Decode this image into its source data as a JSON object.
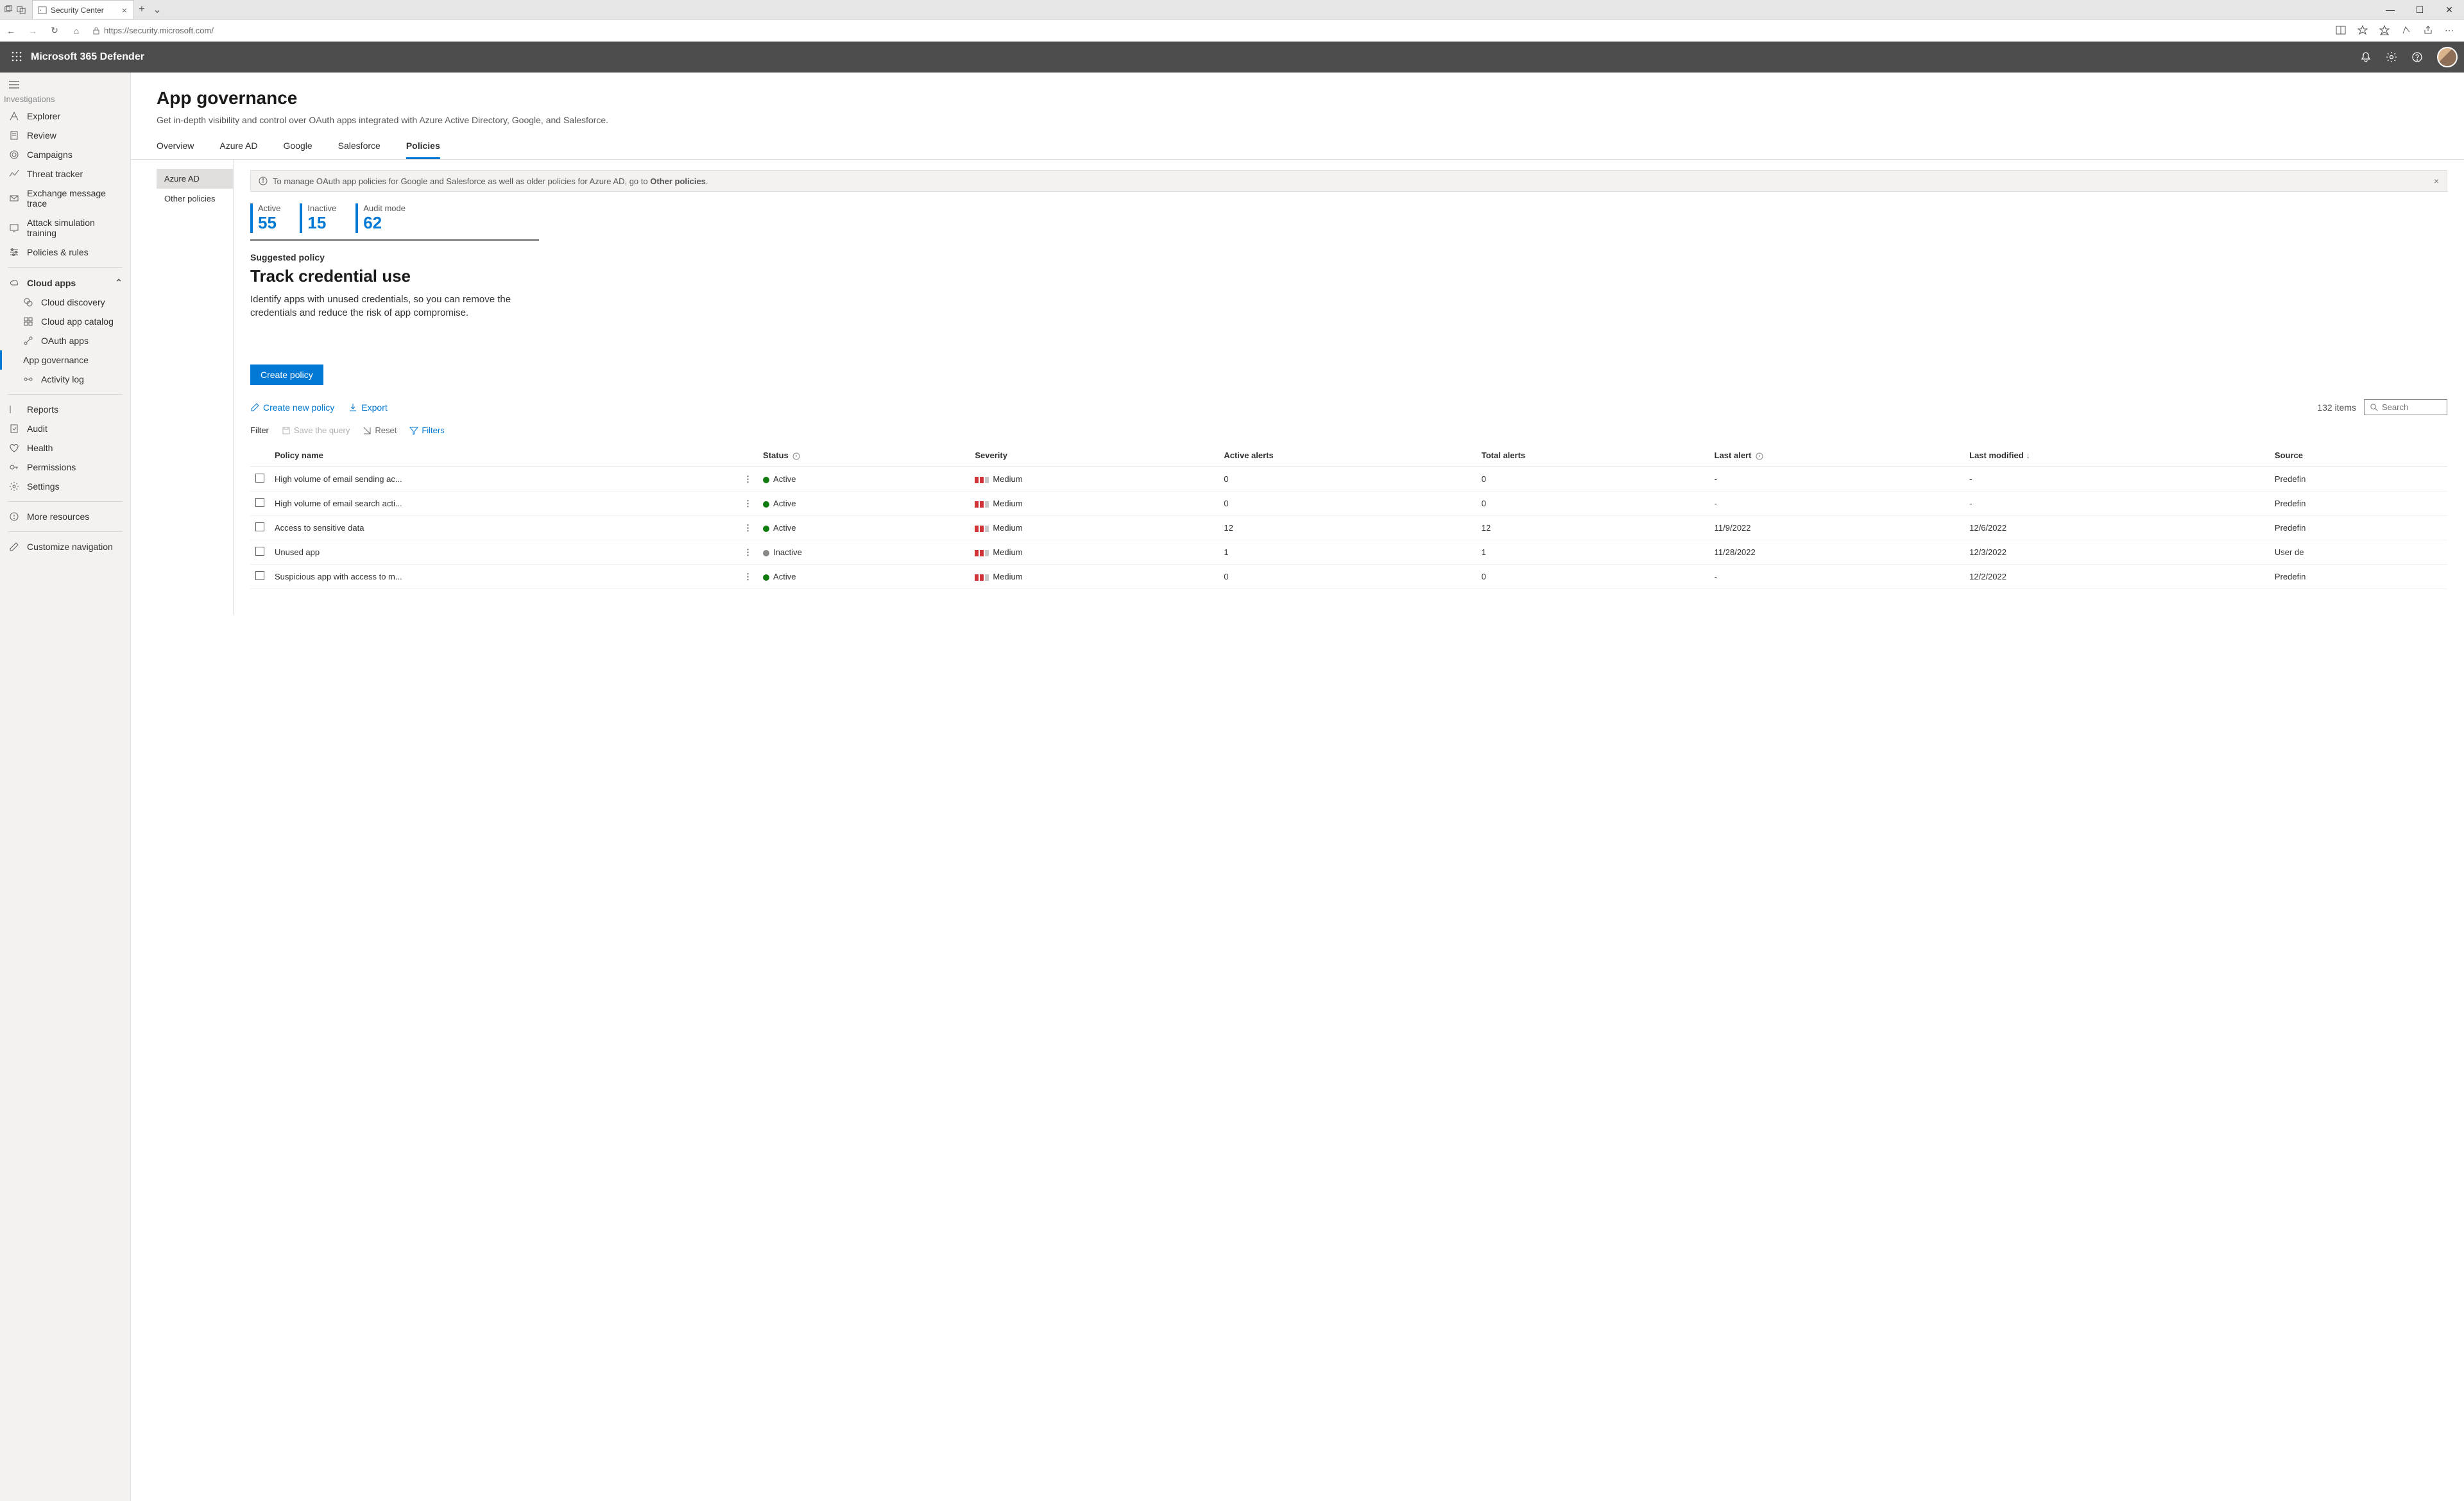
{
  "browser": {
    "tab_title": "Security Center",
    "url": "https://security.microsoft.com/"
  },
  "app_title": "Microsoft 365 Defender",
  "sidebar": {
    "investigations": "Investigations",
    "items_top": [
      {
        "label": "Explorer"
      },
      {
        "label": "Review"
      },
      {
        "label": "Campaigns"
      },
      {
        "label": "Threat tracker"
      },
      {
        "label": "Exchange message trace"
      },
      {
        "label": "Attack simulation training"
      },
      {
        "label": "Policies & rules"
      }
    ],
    "cloud_apps": "Cloud apps",
    "items_cloud": [
      {
        "label": "Cloud discovery"
      },
      {
        "label": "Cloud app catalog"
      },
      {
        "label": "OAuth apps"
      },
      {
        "label": "App governance",
        "selected": true
      },
      {
        "label": "Activity log"
      }
    ],
    "items_bottom": [
      {
        "label": "Reports"
      },
      {
        "label": "Audit"
      },
      {
        "label": "Health"
      },
      {
        "label": "Permissions"
      },
      {
        "label": "Settings"
      }
    ],
    "more": "More resources",
    "customize": "Customize navigation"
  },
  "page": {
    "title": "App governance",
    "subtitle": "Get in-depth visibility and control over OAuth apps integrated with Azure Active Directory, Google, and Salesforce."
  },
  "tabs": [
    "Overview",
    "Azure AD",
    "Google",
    "Salesforce",
    "Policies"
  ],
  "tabs_active": 4,
  "policies_nav": [
    {
      "label": "Azure AD",
      "active": true
    },
    {
      "label": "Other policies"
    }
  ],
  "info_bar": {
    "text_a": "To manage OAuth app policies for Google and Salesforce as well as older policies for Azure AD, go to ",
    "text_b": "Other policies",
    "text_c": "."
  },
  "stats": [
    {
      "label": "Active",
      "value": "55"
    },
    {
      "label": "Inactive",
      "value": "15"
    },
    {
      "label": "Audit mode",
      "value": "62"
    }
  ],
  "suggested": {
    "label": "Suggested policy",
    "title": "Track credential use",
    "desc": "Identify apps with unused credentials, so you can remove the credentials and reduce the risk of app compromise."
  },
  "create_policy": "Create policy",
  "toolbar": {
    "create_new": "Create new policy",
    "export": "Export",
    "items_count": "132 items",
    "search_placeholder": "Search"
  },
  "filter_row": {
    "filter": "Filter",
    "save": "Save the query",
    "reset": "Reset",
    "filters": "Filters"
  },
  "columns": [
    "Policy name",
    "Status",
    "Severity",
    "Active alerts",
    "Total alerts",
    "Last alert",
    "Last modified",
    "Source"
  ],
  "rows": [
    {
      "name": "High volume of email sending ac...",
      "status": "Active",
      "severity": "Medium",
      "active_alerts": "0",
      "total_alerts": "0",
      "last_alert": "-",
      "last_modified": "-",
      "source": "Predefin"
    },
    {
      "name": "High volume of email search acti...",
      "status": "Active",
      "severity": "Medium",
      "active_alerts": "0",
      "total_alerts": "0",
      "last_alert": "-",
      "last_modified": "-",
      "source": "Predefin"
    },
    {
      "name": "Access to sensitive data",
      "status": "Active",
      "severity": "Medium",
      "active_alerts": "12",
      "total_alerts": "12",
      "last_alert": "11/9/2022",
      "last_modified": "12/6/2022",
      "source": "Predefin"
    },
    {
      "name": "Unused app",
      "status": "Inactive",
      "severity": "Medium",
      "active_alerts": "1",
      "total_alerts": "1",
      "last_alert": "11/28/2022",
      "last_modified": "12/3/2022",
      "source": "User de"
    },
    {
      "name": "Suspicious app with access to m...",
      "status": "Active",
      "severity": "Medium",
      "active_alerts": "0",
      "total_alerts": "0",
      "last_alert": "-",
      "last_modified": "12/2/2022",
      "source": "Predefin"
    }
  ]
}
